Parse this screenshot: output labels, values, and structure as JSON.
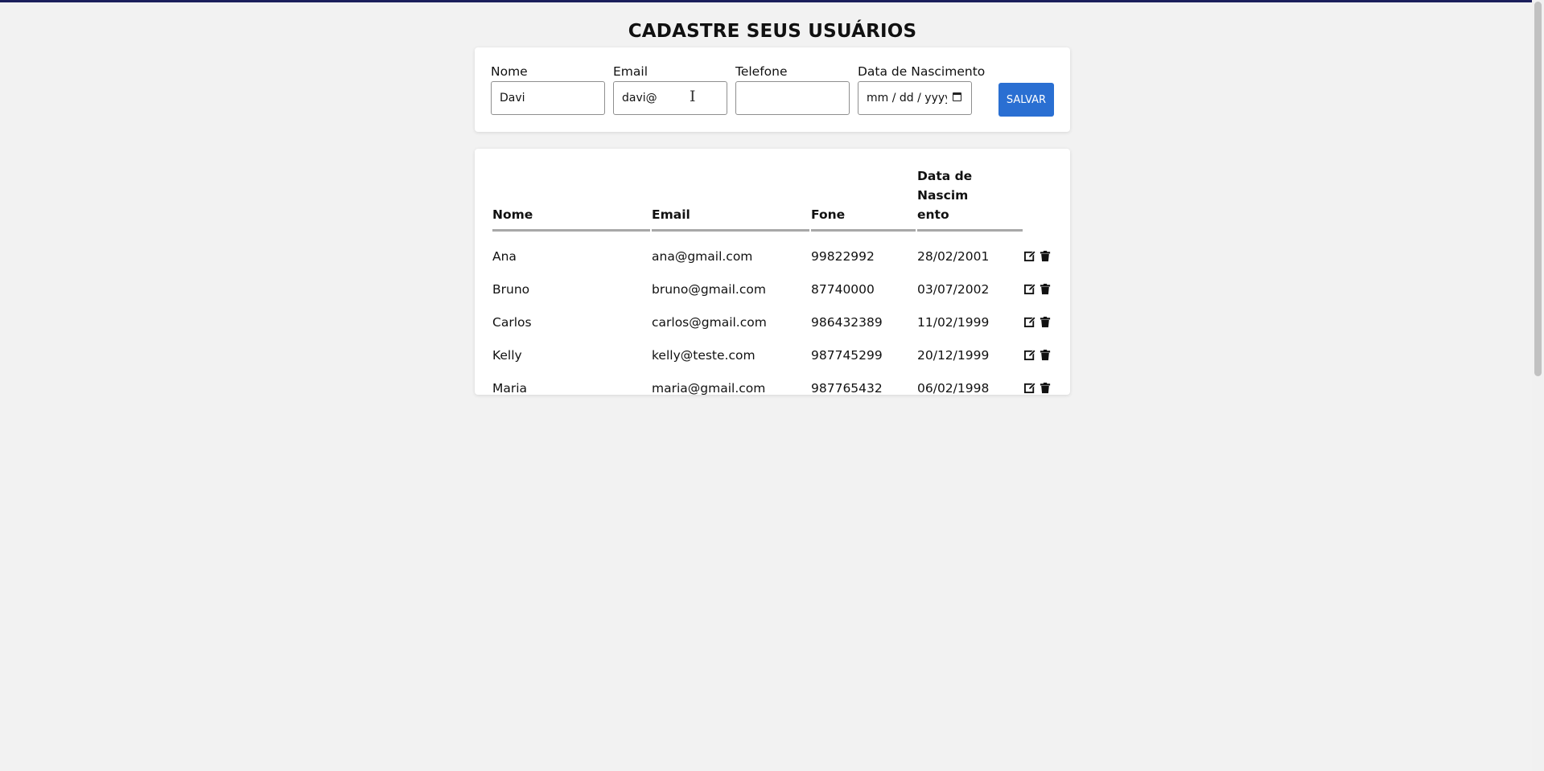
{
  "page": {
    "title": "CADASTRE SEUS USUÁRIOS"
  },
  "form": {
    "nome_label": "Nome",
    "nome_value": "Davi",
    "email_label": "Email",
    "email_value": "davi@",
    "telefone_label": "Telefone",
    "telefone_value": "",
    "data_label": "Data de Nascimento",
    "data_placeholder": "mm / dd / yyyy",
    "save_label": "SALVAR"
  },
  "table": {
    "headers": {
      "nome": "Nome",
      "email": "Email",
      "fone": "Fone",
      "data_line1": "Data de Nascim",
      "data_line2": "ento"
    },
    "rows": [
      {
        "nome": "Ana",
        "email": "ana@gmail.com",
        "fone": "99822992",
        "data": "28/02/2001"
      },
      {
        "nome": "Bruno",
        "email": "bruno@gmail.com",
        "fone": "87740000",
        "data": "03/07/2002"
      },
      {
        "nome": "Carlos",
        "email": "carlos@gmail.com",
        "fone": "986432389",
        "data": "11/02/1999"
      },
      {
        "nome": "Kelly",
        "email": "kelly@teste.com",
        "fone": "987745299",
        "data": "20/12/1999"
      },
      {
        "nome": "Maria",
        "email": "maria@gmail.com",
        "fone": "987765432",
        "data": "06/02/1998"
      }
    ]
  },
  "colors": {
    "accent": "#2a6fd2",
    "top_bar": "#1c1f5c",
    "background": "#f2f2f2"
  },
  "icons": [
    "calendar-icon",
    "text-cursor-icon",
    "edit-icon",
    "trash-icon"
  ]
}
